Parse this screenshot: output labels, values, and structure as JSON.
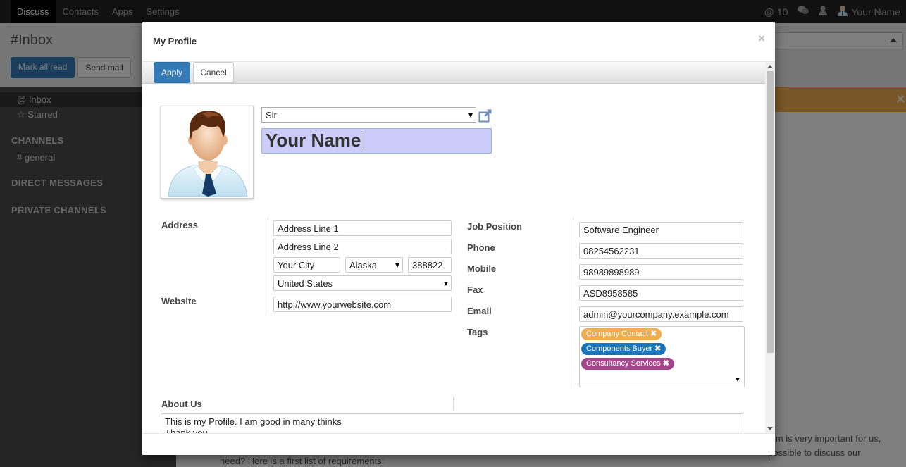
{
  "topbar": {
    "menu": [
      "Discuss",
      "Contacts",
      "Apps",
      "Settings"
    ],
    "notifications": "10",
    "user_name": "Your Name"
  },
  "discuss": {
    "title": "#Inbox",
    "mark_all_read": "Mark all read",
    "send_mail": "Send mail",
    "inbox": "Inbox",
    "starred": "Starred",
    "channels_heading": "CHANNELS",
    "channel_general": "general",
    "direct_messages_heading": "DIRECT MESSAGES",
    "private_channels_heading": "PRIVATE CHANNELS",
    "message_fragment_1": "tem is very important for us,",
    "message_fragment_2": "possible to discuss our",
    "message_fragment_3": "need? Here is a first list of requirements:"
  },
  "modal": {
    "title": "My Profile",
    "apply": "Apply",
    "cancel": "Cancel",
    "title_select": "Sir",
    "name": "Your Name",
    "labels": {
      "address": "Address",
      "website": "Website",
      "job_position": "Job Position",
      "phone": "Phone",
      "mobile": "Mobile",
      "fax": "Fax",
      "email": "Email",
      "tags": "Tags",
      "about_us": "About Us"
    },
    "address": {
      "line1": "Address Line 1",
      "line2": "Address Line 2",
      "city": "Your City",
      "state": "Alaska",
      "zip": "388822",
      "country": "United States"
    },
    "website": "http://www.yourwebsite.com",
    "job_position": "Software Engineer",
    "phone": "08254562231",
    "mobile": "98989898989",
    "fax": "ASD8958585",
    "email": "admin@yourcompany.example.com",
    "tags": [
      {
        "label": "Company Contact",
        "color": "#f0ad4e"
      },
      {
        "label": "Components Buyer",
        "color": "#1b75bc"
      },
      {
        "label": "Consultancy Services",
        "color": "#a24689"
      }
    ],
    "about_line1": "This is my Profile. I am good in many thinks",
    "about_line2": "Thank you"
  }
}
